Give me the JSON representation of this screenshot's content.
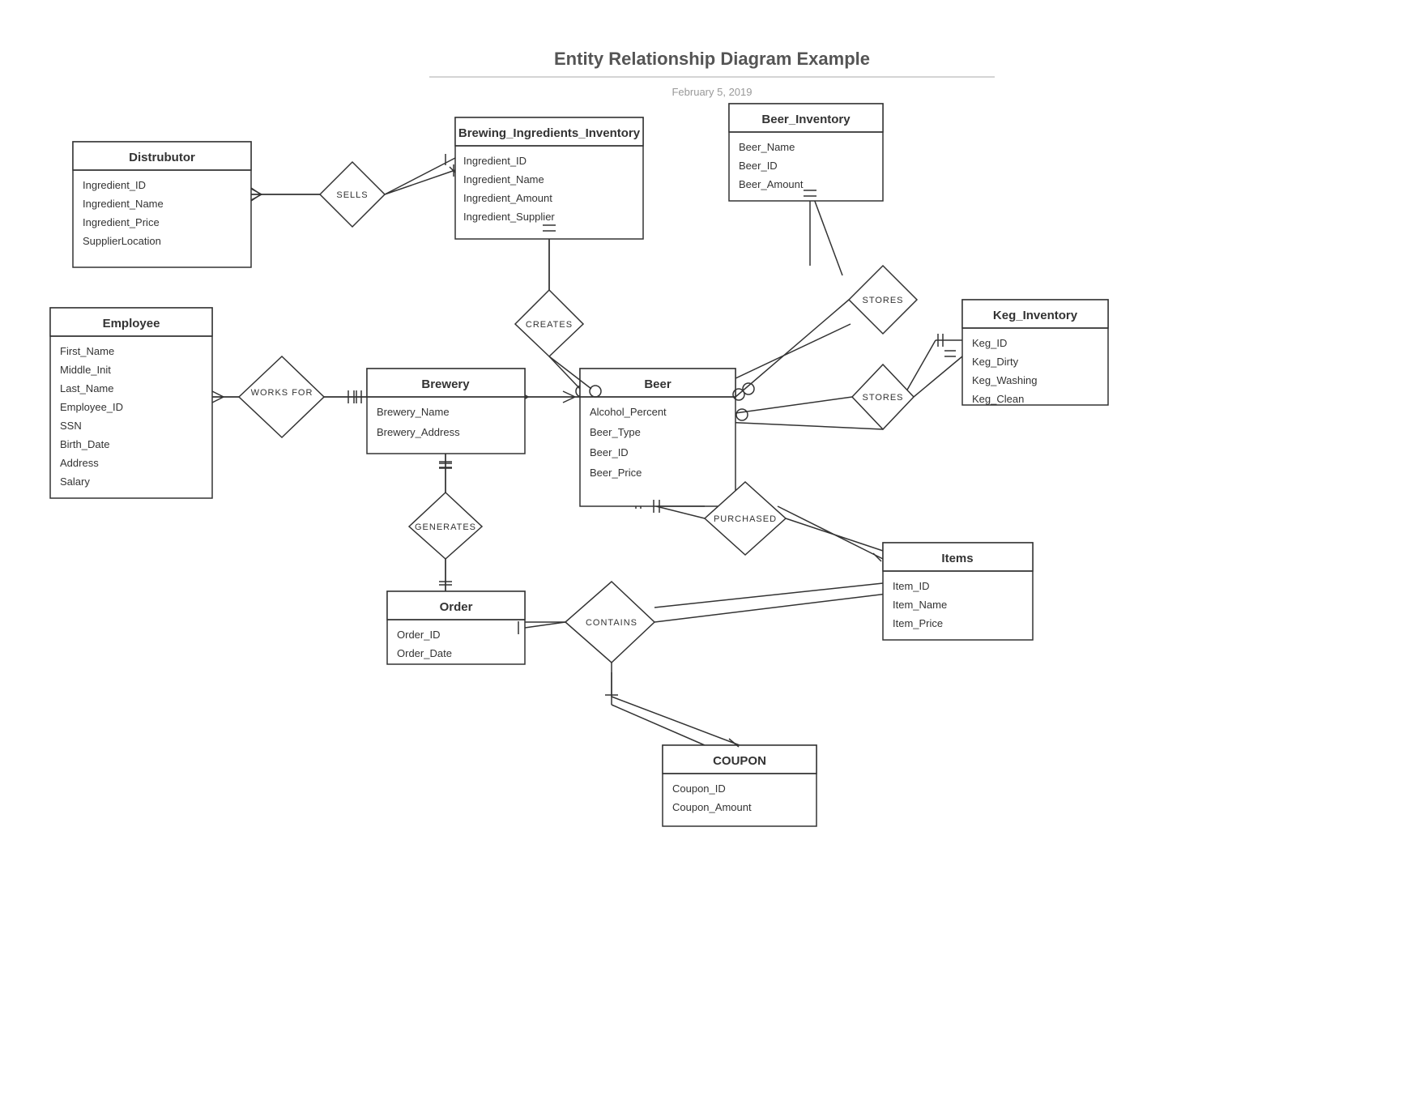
{
  "title": "Entity Relationship Diagram Example",
  "subtitle": "February 5, 2019",
  "entities": {
    "distrubutor": {
      "name": "Distrubutor",
      "attrs": [
        "Ingredient_ID",
        "Ingredient_Name",
        "Ingredient_Price",
        "SupplierLocation"
      ]
    },
    "brewing_ingredients_inventory": {
      "name": "Brewing_Ingredients_Inventory",
      "attrs": [
        "Ingredient_ID",
        "Ingredient_Name",
        "Ingredient_Amount",
        "Ingredient_Supplier"
      ]
    },
    "beer_inventory": {
      "name": "Beer_Inventory",
      "attrs": [
        "Beer_Name",
        "Beer_ID",
        "Beer_Amount"
      ]
    },
    "employee": {
      "name": "Employee",
      "attrs": [
        "First_Name",
        "Middle_Init",
        "Last_Name",
        "Employee_ID",
        "SSN",
        "Birth_Date",
        "Address",
        "Salary"
      ]
    },
    "brewery": {
      "name": "Brewery",
      "attrs": [
        "Brewery_Name",
        "Brewery_Address"
      ]
    },
    "beer": {
      "name": "Beer",
      "attrs": [
        "Alcohol_Percent",
        "Beer_Type",
        "Beer_ID",
        "Beer_Price"
      ]
    },
    "keg_inventory": {
      "name": "Keg_Inventory",
      "attrs": [
        "Keg_ID",
        "Keg_Dirty",
        "Keg_Washing",
        "Keg_Clean"
      ]
    },
    "order": {
      "name": "Order",
      "attrs": [
        "Order_ID",
        "Order_Date"
      ]
    },
    "items": {
      "name": "Items",
      "attrs": [
        "Item_ID",
        "Item_Name",
        "Item_Price"
      ]
    },
    "coupon": {
      "name": "COUPON",
      "attrs": [
        "Coupon_ID",
        "Coupon_Amount"
      ]
    }
  },
  "relationships": {
    "sells": "SELLS",
    "creates": "CREATES",
    "stores1": "STORES",
    "stores2": "STORES",
    "works_for": "WORKS FOR",
    "generates": "GENERATES",
    "purchased": "PURCHASED",
    "contains": "CONTAINS"
  }
}
